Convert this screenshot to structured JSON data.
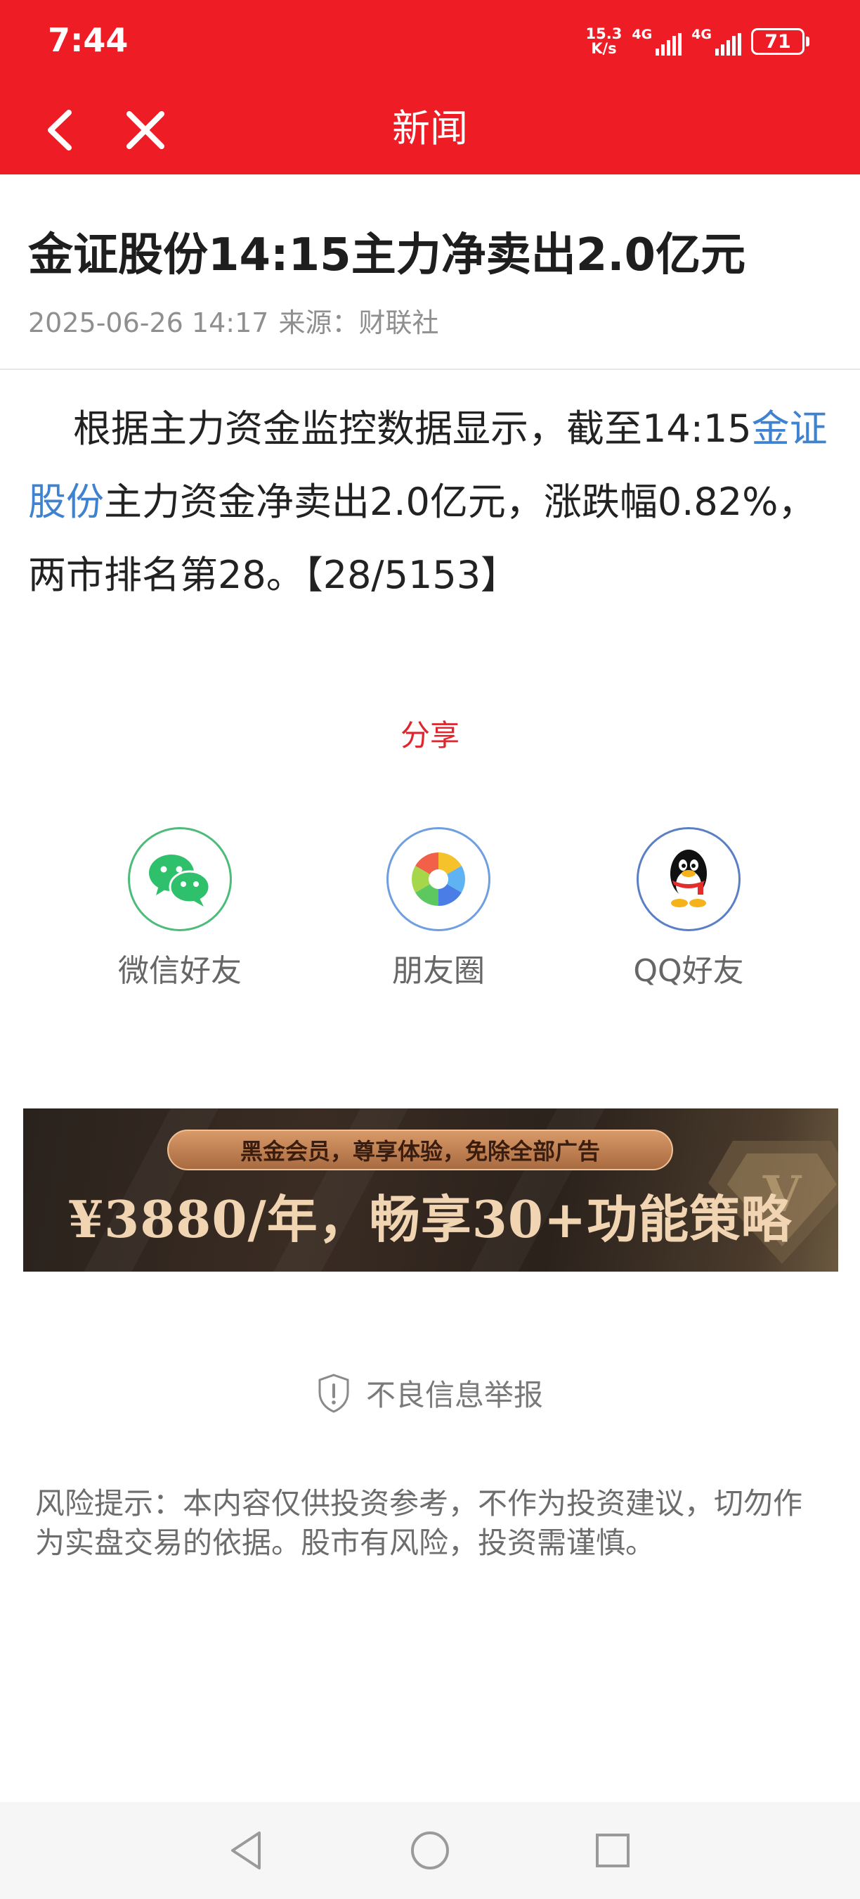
{
  "status_bar": {
    "time": "7:44",
    "net_speed_value": "15.3",
    "net_speed_unit": "K/s",
    "signal1_label": "4G",
    "signal2_label": "4G",
    "battery": "71"
  },
  "header": {
    "title": "新闻"
  },
  "article": {
    "headline": "金证股份14:15主力净卖出2.0亿元",
    "date": "2025-06-26 14:17",
    "source_label": "来源：",
    "source": "财联社",
    "body_intro": "根据主力资金监控数据显示，截至14:15",
    "stock_link": "金证股份",
    "body_rest": "主力资金净卖出2.0亿元，涨跌幅0.82%，两市排名第28。【28/5153】"
  },
  "share": {
    "title": "分享",
    "items": [
      {
        "label": "微信好友",
        "icon": "wechat-icon"
      },
      {
        "label": "朋友圈",
        "icon": "moments-icon"
      },
      {
        "label": "QQ好友",
        "icon": "qq-icon"
      }
    ]
  },
  "banner": {
    "tagline": "黑金会员，尊享体验，免除全部广告",
    "offer": "¥3880/年，畅享30+功能策略"
  },
  "report": {
    "label": "不良信息举报",
    "icon": "shield-alert-icon"
  },
  "disclaimer": "风险提示：本内容仅供投资参考，不作为投资建议，切勿作为实盘交易的依据。股市有风险，投资需谨慎。",
  "colors": {
    "brand_red": "#ee1c25",
    "link_blue": "#3f83d0",
    "share_title_red": "#e0262d"
  }
}
